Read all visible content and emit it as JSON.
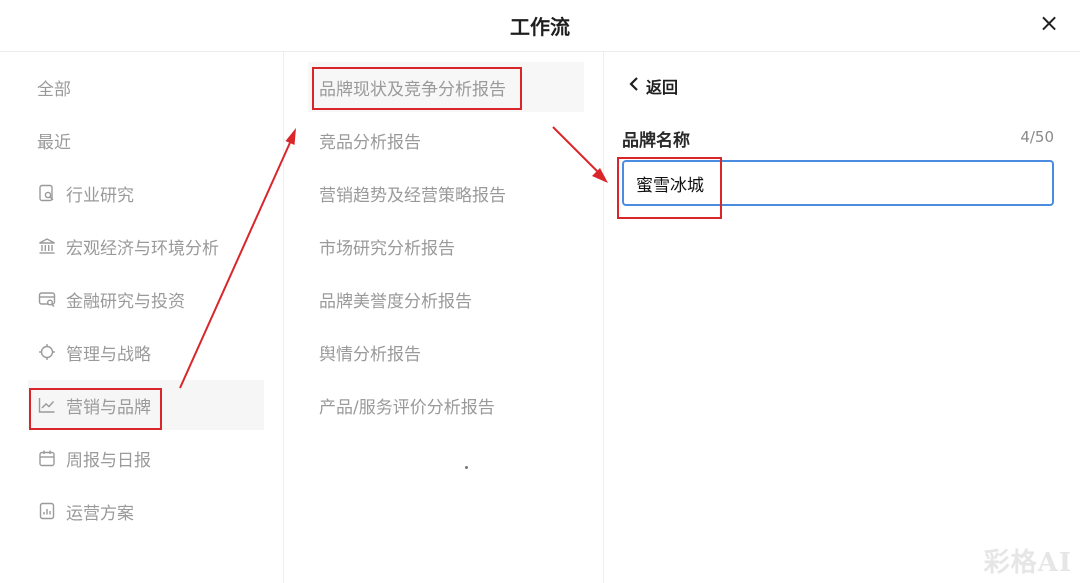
{
  "header": {
    "title": "工作流",
    "close_glyph": "×"
  },
  "categories": [
    {
      "label": "全部",
      "icon": ""
    },
    {
      "label": "最近",
      "icon": ""
    },
    {
      "label": "行业研究",
      "icon": "document-search-icon"
    },
    {
      "label": "宏观经济与环境分析",
      "icon": "bank-icon"
    },
    {
      "label": "金融研究与投资",
      "icon": "card-search-icon"
    },
    {
      "label": "管理与战略",
      "icon": "target-icon"
    },
    {
      "label": "营销与品牌",
      "icon": "trend-chart-icon",
      "active": true
    },
    {
      "label": "周报与日报",
      "icon": "calendar-icon"
    },
    {
      "label": "运营方案",
      "icon": "report-icon"
    }
  ],
  "templates": [
    {
      "label": "品牌现状及竞争分析报告",
      "active": true
    },
    {
      "label": "竞品分析报告"
    },
    {
      "label": "营销趋势及经营策略报告"
    },
    {
      "label": "市场研究分析报告"
    },
    {
      "label": "品牌美誉度分析报告"
    },
    {
      "label": "舆情分析报告"
    },
    {
      "label": "产品/服务评价分析报告"
    }
  ],
  "form": {
    "back_label": "返回",
    "field_label": "品牌名称",
    "counter": "4/50",
    "value": "蜜雪冰城"
  },
  "watermark": "彩格AI",
  "colors": {
    "annotation_red": "#d9262b",
    "input_border": "#4c8ce0"
  }
}
